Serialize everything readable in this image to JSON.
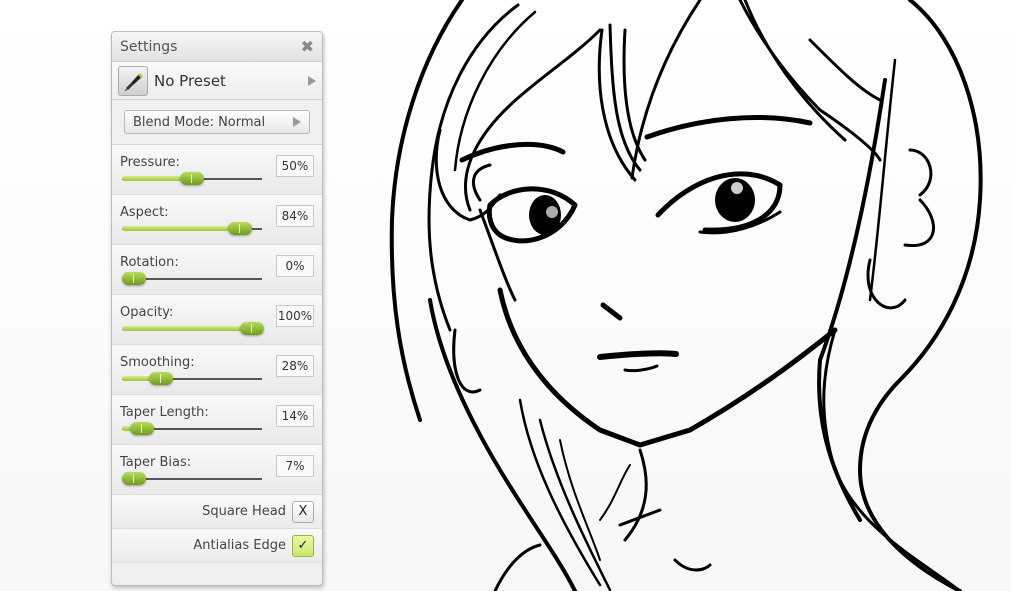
{
  "panel": {
    "title": "Settings",
    "close_icon": "close-icon",
    "preset": {
      "label": "No Preset",
      "icon": "ink-pen-icon"
    },
    "blend_mode": {
      "label": "Blend Mode: Normal"
    },
    "sliders": [
      {
        "label": "Pressure:",
        "value": "50%",
        "fraction": 0.5
      },
      {
        "label": "Aspect:",
        "value": "84%",
        "fraction": 0.84
      },
      {
        "label": "Rotation:",
        "value": "0%",
        "fraction": 0.0
      },
      {
        "label": "Opacity:",
        "value": "100%",
        "fraction": 1.0
      },
      {
        "label": "Smoothing:",
        "value": "28%",
        "fraction": 0.28
      },
      {
        "label": "Taper Length:",
        "value": "14%",
        "fraction": 0.14
      },
      {
        "label": "Taper Bias:",
        "value": "7%",
        "fraction": 0.07
      }
    ],
    "checks": [
      {
        "label": "Square Head",
        "state": "X",
        "on": false
      },
      {
        "label": "Antialias Edge",
        "state": "✓",
        "on": true
      }
    ]
  },
  "colors": {
    "accent": "#9cc33a",
    "check_on": "#d7f07e"
  }
}
